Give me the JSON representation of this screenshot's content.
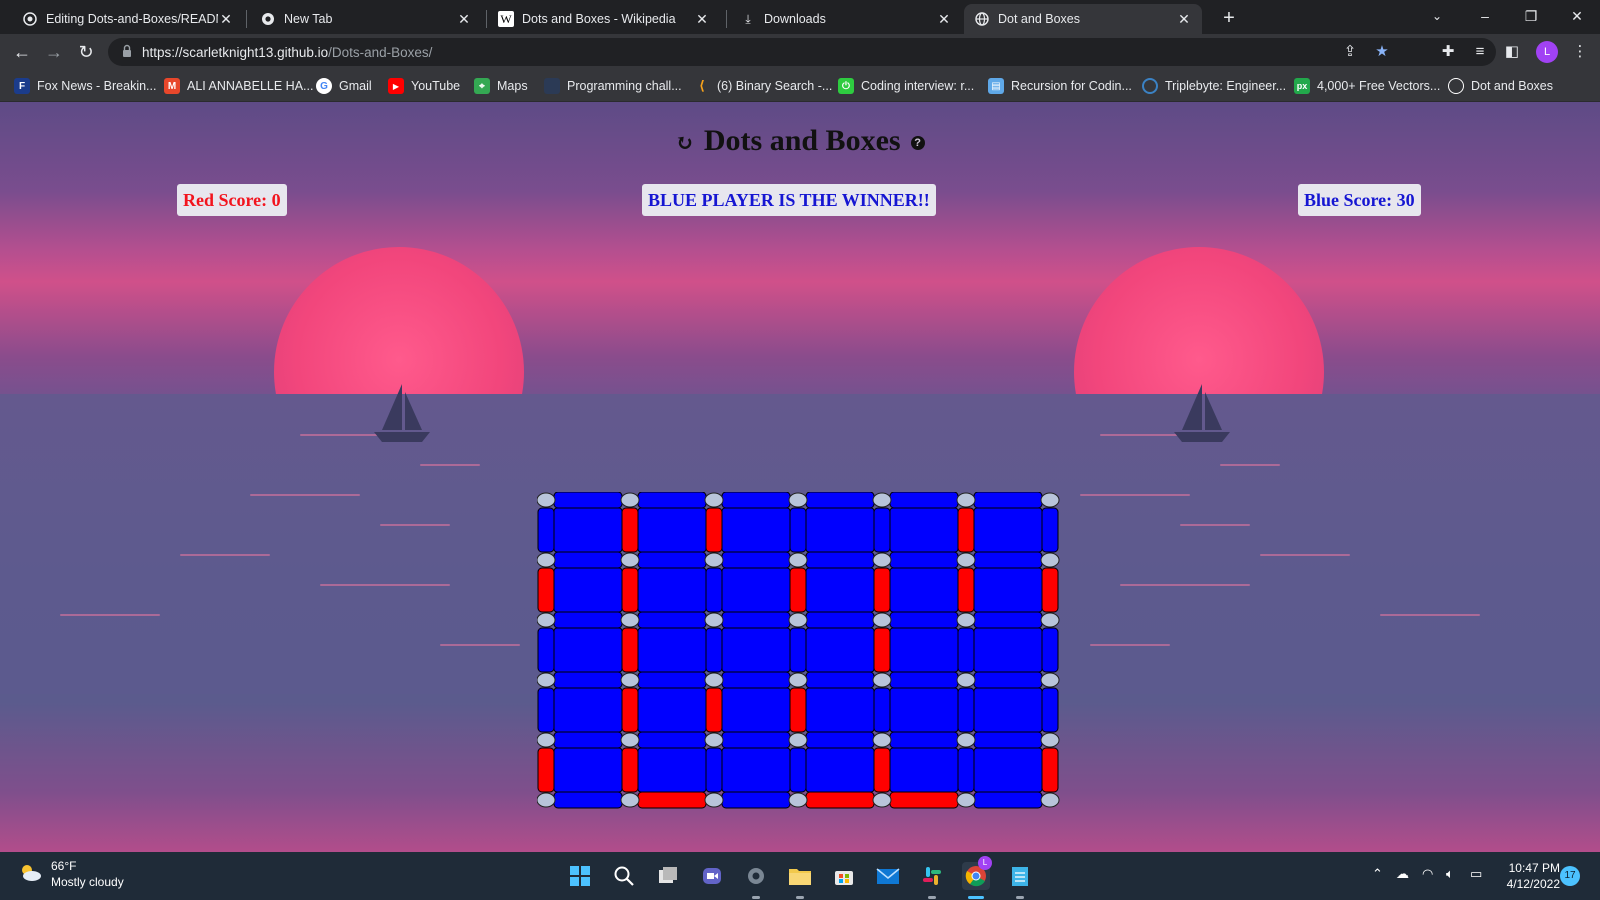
{
  "browser": {
    "tabs": [
      {
        "title": "Editing Dots-and-Boxes/README.md",
        "icon": "github-icon"
      },
      {
        "title": "New Tab",
        "icon": "chrome-icon"
      },
      {
        "title": "Dots and Boxes - Wikipedia",
        "icon": "wikipedia-icon"
      },
      {
        "title": "Downloads",
        "icon": "download-icon"
      },
      {
        "title": "Dot and Boxes",
        "icon": "globe-icon",
        "active": true
      }
    ],
    "url_host": "https://scarletknight13.github.io",
    "url_path": "/Dots-and-Boxes/",
    "profile_initial": "L",
    "bookmarks": [
      {
        "label": "Fox News - Breakin...",
        "icon": "foxnews-icon",
        "color": "#1b3c8c"
      },
      {
        "label": "ALI ANNABELLE HA...",
        "icon": "gmail-shield-icon",
        "color": "#e8472b"
      },
      {
        "label": "Gmail",
        "icon": "google-icon",
        "color": "#ffffff"
      },
      {
        "label": "YouTube",
        "icon": "youtube-icon",
        "color": "#ff0000"
      },
      {
        "label": "Maps",
        "icon": "maps-icon",
        "color": "#34a853"
      },
      {
        "label": "Programming chall...",
        "icon": "code-icon",
        "color": "#2b3a55"
      },
      {
        "label": "(6) Binary Search -...",
        "icon": "leetcode-icon",
        "color": "#f7a21b"
      },
      {
        "label": "Coding interview: r...",
        "icon": "power-icon",
        "color": "#2ecc40"
      },
      {
        "label": "Recursion for Codin...",
        "icon": "book-icon",
        "color": "#5fa8e8"
      },
      {
        "label": "Triplebyte: Engineer...",
        "icon": "triplebyte-icon",
        "color": "#3b82c4"
      },
      {
        "label": "4,000+ Free Vectors...",
        "icon": "px-icon",
        "color": "#22a84b"
      },
      {
        "label": "Dot and Boxes",
        "icon": "globe-icon",
        "color": "#ffffff"
      }
    ]
  },
  "game": {
    "title": "Dots and Boxes",
    "red_score_label": "Red Score: 0",
    "blue_score_label": "Blue Score: 30",
    "winner_banner": "BLUE PLAYER IS THE WINNER!!",
    "red_score": 0,
    "blue_score": 30,
    "colors": {
      "red": "#ff0000",
      "blue": "#0000ff",
      "dot": "#b8c4da"
    },
    "board": {
      "box_cols": 6,
      "box_rows": 5,
      "box_owner": [
        [
          "B",
          "B",
          "B",
          "B",
          "B",
          "B"
        ],
        [
          "B",
          "B",
          "B",
          "B",
          "B",
          "B"
        ],
        [
          "B",
          "B",
          "B",
          "B",
          "B",
          "B"
        ],
        [
          "B",
          "B",
          "B",
          "B",
          "B",
          "B"
        ],
        [
          "B",
          "B",
          "B",
          "B",
          "B",
          "B"
        ]
      ],
      "h_lines": [
        [
          "B",
          "B",
          "B",
          "B",
          "B",
          "B"
        ],
        [
          "B",
          "B",
          "B",
          "B",
          "B",
          "B"
        ],
        [
          "B",
          "B",
          "B",
          "B",
          "B",
          "B"
        ],
        [
          "B",
          "B",
          "B",
          "B",
          "B",
          "B"
        ],
        [
          "B",
          "B",
          "B",
          "B",
          "B",
          "B"
        ],
        [
          "B",
          "R",
          "B",
          "R",
          "R",
          "B"
        ]
      ],
      "v_lines": [
        [
          "B",
          "R",
          "R",
          "B",
          "B",
          "R",
          "B",
          "B"
        ],
        [
          "R",
          "R",
          "B",
          "R",
          "R",
          "R",
          "R"
        ],
        [
          "B",
          "R",
          "B",
          "B",
          "R",
          "B",
          "B"
        ],
        [
          "B",
          "R",
          "R",
          "R",
          "B",
          "B",
          "B"
        ],
        [
          "R",
          "R",
          "B",
          "B",
          "R",
          "B",
          "R"
        ]
      ]
    }
  },
  "taskbar": {
    "temperature": "66°F",
    "weather": "Mostly cloudy",
    "time": "10:47 PM",
    "date": "4/12/2022",
    "notifications": "17",
    "chrome_badge": "L"
  }
}
